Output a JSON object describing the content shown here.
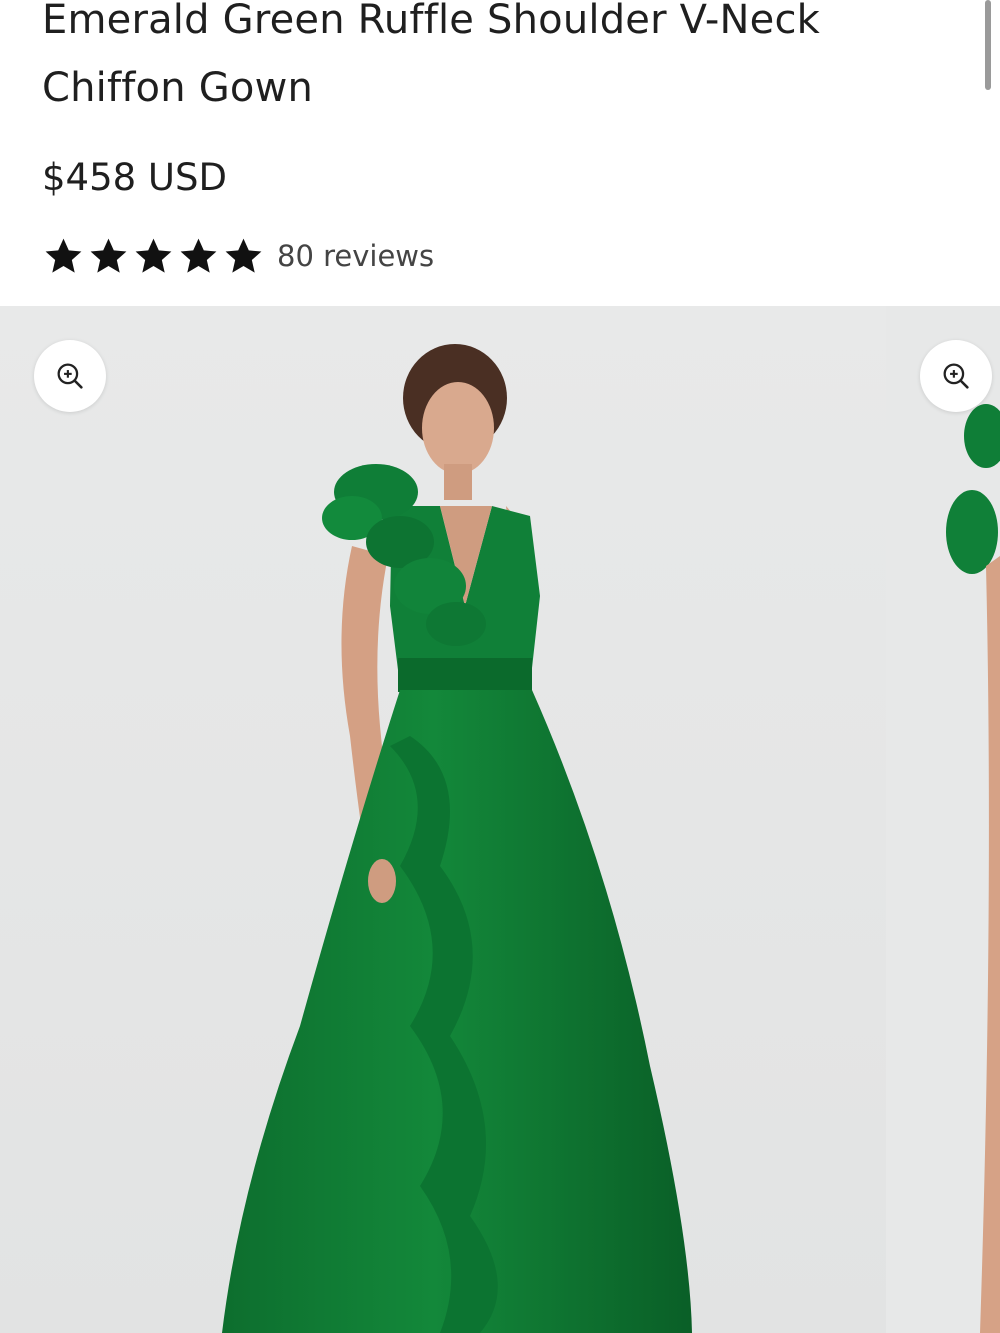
{
  "product": {
    "title": "Emerald Green Ruffle Shoulder V-Neck Chiffon Gown",
    "price": "$458 USD",
    "rating": {
      "stars": 5,
      "max_stars": 5,
      "reviews_label": "80 reviews"
    }
  },
  "gallery": {
    "zoom_icon": "zoom-in-icon",
    "slides": [
      {
        "subject": "model in emerald green ruffle gown"
      },
      {
        "subject": "partial next product image"
      }
    ]
  },
  "colors": {
    "text": "#1f1f1f",
    "gown": "#0f7a34",
    "image_background": "#e9eaea"
  }
}
